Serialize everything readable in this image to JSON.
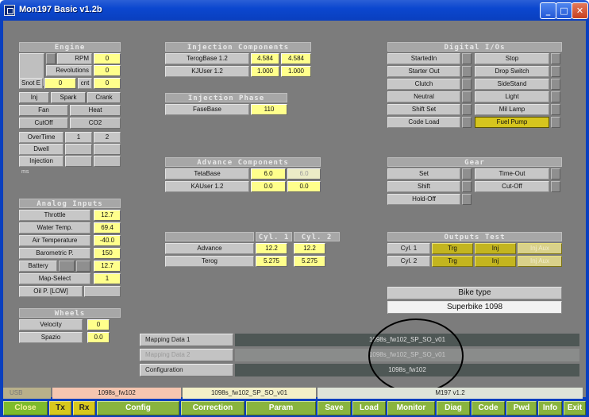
{
  "window": {
    "title": "Mon197 Basic v1.2b"
  },
  "engine": {
    "title": "Engine",
    "rpm_label": "RPM",
    "rpm": "0",
    "revolutions_label": "Revolutions",
    "revolutions": "0",
    "snot_label": "Snot E",
    "snot": "0",
    "cnt_label": "cnt",
    "cnt": "0",
    "inj": "Inj",
    "spark": "Spark",
    "crank": "Crank",
    "fan": "Fan",
    "heat": "Heat",
    "cutoff": "CutOff",
    "co2": "CO2",
    "overtime": "OverTime",
    "col1": "1",
    "col2": "2",
    "dwell": "Dwell",
    "injection": "Injection",
    "units": "ms"
  },
  "analog": {
    "title": "Analog Inputs",
    "rows": [
      {
        "label": "Throttle",
        "value": "12.7"
      },
      {
        "label": "Water Temp.",
        "value": "69.4"
      },
      {
        "label": "Air Temperature",
        "value": "-40.0"
      },
      {
        "label": "Barometric P.",
        "value": "150"
      },
      {
        "label": "Battery",
        "value": "12.7"
      },
      {
        "label": "Map-Select",
        "value": "1"
      }
    ],
    "oil": "Oil P. [LOW]"
  },
  "wheels": {
    "title": "Wheels",
    "velocity_label": "Velocity",
    "velocity": "0",
    "spazio_label": "Spazio",
    "spazio": "0.0"
  },
  "injection_comp": {
    "title": "Injection Components",
    "row1_label": "TerogBase 1.2",
    "row1_v1": "4.584",
    "row1_v2": "4.584",
    "row2_label": "KJUser 1.2",
    "row2_v1": "1.000",
    "row2_v2": "1.000"
  },
  "injection_phase": {
    "title": "Injection Phase",
    "label": "FaseBase",
    "value": "110"
  },
  "advance_comp": {
    "title": "Advance Components",
    "row1_label": "TetaBase",
    "row1_v1": "6.0",
    "row1_v2": "6.0",
    "row2_label": "KAUser 1.2",
    "row2_v1": "0.0",
    "row2_v2": "0.0"
  },
  "cyl_table": {
    "col1": "Cyl. 1",
    "col2": "Cyl. 2",
    "advance_label": "Advance",
    "advance_v1": "12.2",
    "advance_v2": "12.2",
    "terog_label": "Terog",
    "terog_v1": "5.275",
    "terog_v2": "5.275"
  },
  "digital": {
    "title": "Digital I/Os",
    "left": [
      "StartedIn",
      "Starter Out",
      "Clutch",
      "Neutral",
      "Shift Set",
      "Code Load"
    ],
    "right": [
      "Stop",
      "Drop Switch",
      "SideStand",
      "Light",
      "Mil Lamp",
      "Fuel Pump"
    ]
  },
  "gear": {
    "title": "Gear",
    "set": "Set",
    "shift": "Shift",
    "holdoff": "Hold-Off",
    "timeout": "Time-Out",
    "cutoff": "Cut-Off"
  },
  "outputs_test": {
    "title": "Outputs Test",
    "cyl1": "Cyl. 1",
    "cyl2": "Cyl. 2",
    "trg": "Trg",
    "inj": "Inj",
    "injaux": "Inj Aux"
  },
  "bike": {
    "title": "Bike type",
    "value": "Superbike 1098"
  },
  "mapping": {
    "map1_label": "Mapping Data 1",
    "map1_value": "1098s_fw102_SP_SO_v01",
    "map2_label": "Mapping Data 2",
    "map2_value": "1098s_fw102_SP_SO_v01",
    "config_label": "Configuration",
    "config_value": "1098s_fw102"
  },
  "status": {
    "usb": "USB",
    "config_file": "1098s_fw102",
    "mapping_file": "1098s_fw102_SP_SO_v01",
    "version": "M197 v1.2"
  },
  "toolbar": {
    "close": "Close",
    "tx": "Tx",
    "rx": "Rx",
    "config": "Config",
    "correction": "Correction",
    "param": "Param",
    "save": "Save",
    "load": "Load",
    "monitor": "Monitor",
    "diag": "Diag",
    "code": "Code",
    "pwd": "Pwd",
    "info": "Info",
    "exit": "Exit"
  }
}
